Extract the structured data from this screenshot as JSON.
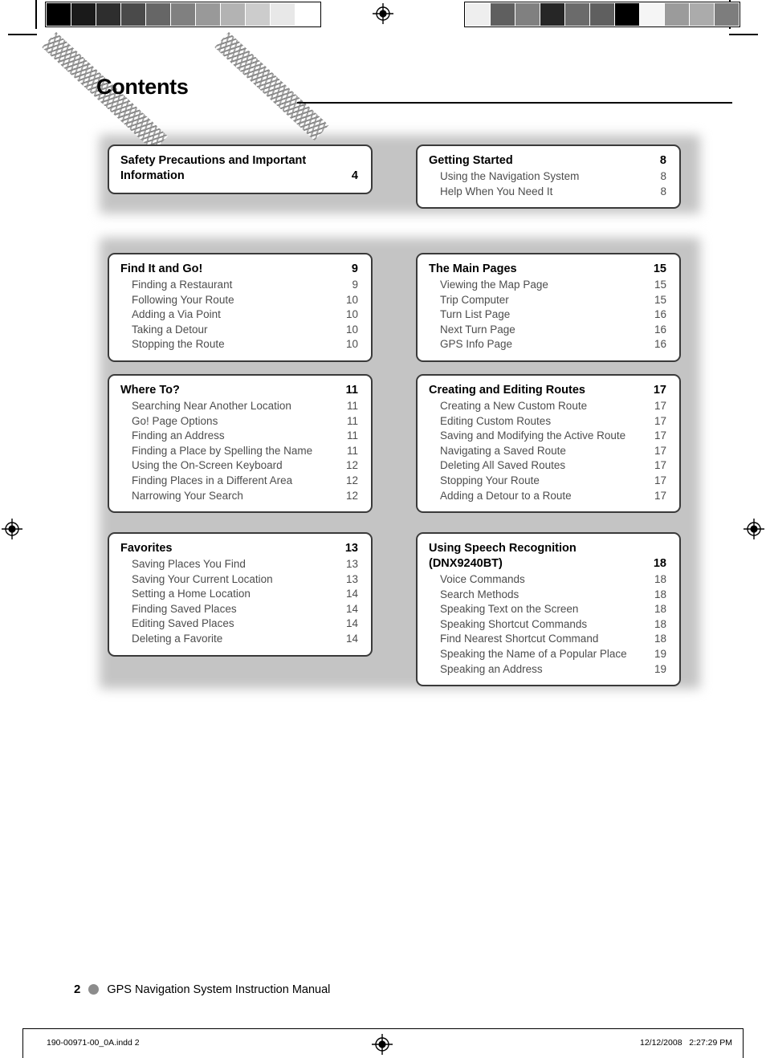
{
  "page": {
    "title": "Contents",
    "footer": {
      "number": "2",
      "text": "GPS Navigation System Instruction Manual",
      "dot_icon": "bullet-dot-icon"
    },
    "print_bar": {
      "file": "190-00971-00_0A.indd   2",
      "date": "12/12/2008   2:27:29 PM",
      "registration_icon": "registration-target-icon"
    },
    "decor": {
      "tread_band_icon": "tire-tread-band-icon",
      "registration_icon": "registration-target-icon",
      "crop_mark_icon": "crop-mark-icon"
    }
  },
  "colors": {
    "box_border": "#3a3a3a",
    "backdrop_gray": "#c4c4c4",
    "entry_text": "#4d4d4d",
    "heading_text": "#000000",
    "footer_dot": "#8c8c8c"
  },
  "calibration": {
    "left_bar_label": "grayscale-calibration-bar",
    "left_swatches": [
      "#000000",
      "#1a1a1a",
      "#2e2e2e",
      "#4a4a4a",
      "#666666",
      "#808080",
      "#999999",
      "#b3b3b3",
      "#cccccc",
      "#e8e8e8",
      "#ffffff"
    ],
    "right_bar_label": "grayscale-calibration-bar",
    "right_swatches": [
      "#eeeeee",
      "#5f5f5f",
      "#808080",
      "#262626",
      "#6b6b6b",
      "#5f5f5f",
      "#000000",
      "#f5f5f5",
      "#9b9b9b",
      "#ababab",
      "#7d7d7d"
    ]
  },
  "toc": {
    "boxes": [
      {
        "id": "safety-precautions",
        "heading": "Safety Precautions and Important",
        "heading_line2": "Information",
        "two_line": true,
        "page": "4",
        "entries": []
      },
      {
        "id": "getting-started",
        "heading": "Getting Started",
        "two_line": false,
        "page": "8",
        "entries": [
          {
            "title": "Using the Navigation System",
            "page": "8"
          },
          {
            "title": "Help When You Need It",
            "page": "8"
          }
        ]
      },
      {
        "id": "find-it-and-go",
        "heading": "Find It and Go!",
        "two_line": false,
        "page": "9",
        "entries": [
          {
            "title": "Finding a Restaurant",
            "page": "9"
          },
          {
            "title": "Following Your Route",
            "page": "10"
          },
          {
            "title": "Adding a Via Point",
            "page": "10"
          },
          {
            "title": "Taking a Detour",
            "page": "10"
          },
          {
            "title": "Stopping the Route",
            "page": "10"
          }
        ]
      },
      {
        "id": "the-main-pages",
        "heading": "The Main Pages",
        "two_line": false,
        "page": "15",
        "entries": [
          {
            "title": "Viewing the Map Page",
            "page": "15"
          },
          {
            "title": "Trip Computer",
            "page": "15"
          },
          {
            "title": "Turn List Page",
            "page": "16"
          },
          {
            "title": "Next Turn Page",
            "page": "16"
          },
          {
            "title": "GPS Info Page",
            "page": "16"
          }
        ]
      },
      {
        "id": "where-to",
        "heading": "Where To?",
        "two_line": false,
        "page": "11",
        "entries": [
          {
            "title": "Searching Near Another Location",
            "page": "11"
          },
          {
            "title": "Go! Page Options",
            "page": "11"
          },
          {
            "title": "Finding an Address",
            "page": "11"
          },
          {
            "title": "Finding a Place by Spelling the Name",
            "page": "11"
          },
          {
            "title": "Using the On-Screen Keyboard",
            "page": "12"
          },
          {
            "title": "Finding Places in a Different Area",
            "page": "12"
          },
          {
            "title": "Narrowing Your Search",
            "page": "12"
          }
        ]
      },
      {
        "id": "creating-and-editing-routes",
        "heading": "Creating and Editing Routes",
        "two_line": false,
        "page": "17",
        "entries": [
          {
            "title": "Creating a New Custom Route",
            "page": "17"
          },
          {
            "title": "Editing Custom Routes",
            "page": "17"
          },
          {
            "title": "Saving and Modifying the Active Route",
            "page": "17"
          },
          {
            "title": "Navigating a Saved Route",
            "page": "17"
          },
          {
            "title": "Deleting All Saved Routes",
            "page": "17"
          },
          {
            "title": "Stopping Your Route",
            "page": "17"
          },
          {
            "title": "Adding a Detour to a Route",
            "page": "17"
          }
        ]
      },
      {
        "id": "favorites",
        "heading": "Favorites",
        "two_line": false,
        "page": "13",
        "entries": [
          {
            "title": "Saving Places You Find",
            "page": "13"
          },
          {
            "title": "Saving Your Current Location",
            "page": "13"
          },
          {
            "title": "Setting a Home Location",
            "page": "14"
          },
          {
            "title": "Finding Saved Places",
            "page": "14"
          },
          {
            "title": "Editing Saved Places",
            "page": "14"
          },
          {
            "title": "Deleting a Favorite",
            "page": "14"
          }
        ]
      },
      {
        "id": "using-speech-recognition",
        "heading": "Using Speech Recognition",
        "heading_line2": "(DNX9240BT)",
        "two_line": true,
        "page": "18",
        "entries": [
          {
            "title": "Voice Commands",
            "page": "18"
          },
          {
            "title": "Search Methods",
            "page": "18"
          },
          {
            "title": "Speaking Text on the Screen",
            "page": "18"
          },
          {
            "title": "Speaking Shortcut Commands",
            "page": "18"
          },
          {
            "title": "Find Nearest Shortcut Command",
            "page": "18"
          },
          {
            "title": "Speaking the Name of a Popular Place",
            "page": "19"
          },
          {
            "title": "Speaking an Address",
            "page": "19"
          }
        ]
      }
    ]
  }
}
